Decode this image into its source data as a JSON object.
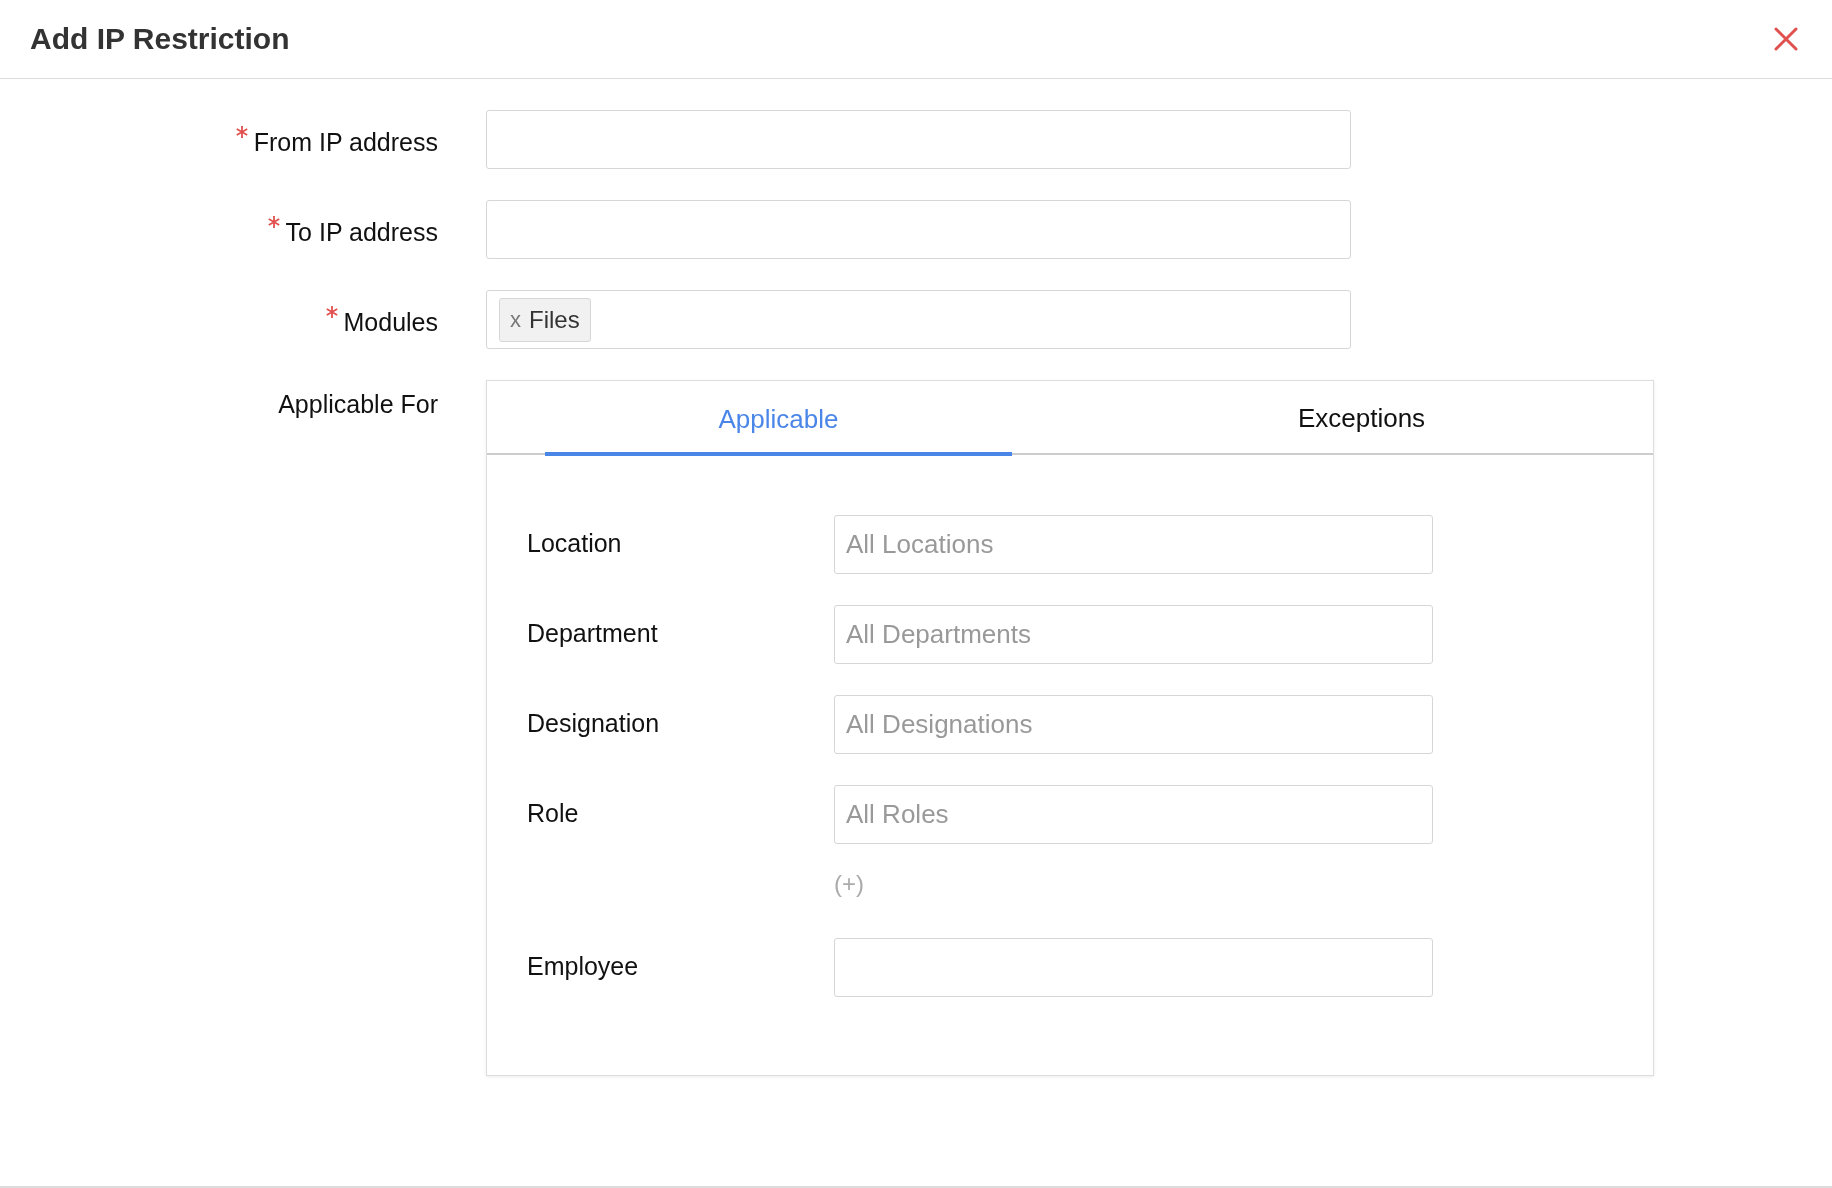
{
  "window": {
    "title": "Add IP Restriction"
  },
  "fields": [
    {
      "label": "From IP address",
      "required": true,
      "kind": "input"
    },
    {
      "label": "To IP address",
      "required": true,
      "kind": "input"
    },
    {
      "label": "Modules",
      "required": true,
      "kind": "tags",
      "tags": [
        {
          "remove": "x",
          "label": "Files"
        }
      ]
    }
  ],
  "applicable_for": {
    "label": "Applicable For",
    "tabs": [
      {
        "label": "Applicable",
        "selected": true
      },
      {
        "label": "Exceptions",
        "selected": false
      }
    ],
    "rows": [
      {
        "label": "Location",
        "placeholder": "All Locations"
      },
      {
        "label": "Department",
        "placeholder": "All Departments"
      },
      {
        "label": "Designation",
        "placeholder": "All Designations"
      },
      {
        "label": "Role",
        "placeholder": "All Roles"
      }
    ],
    "add_link": "(+)",
    "employee": {
      "label": "Employee"
    }
  }
}
